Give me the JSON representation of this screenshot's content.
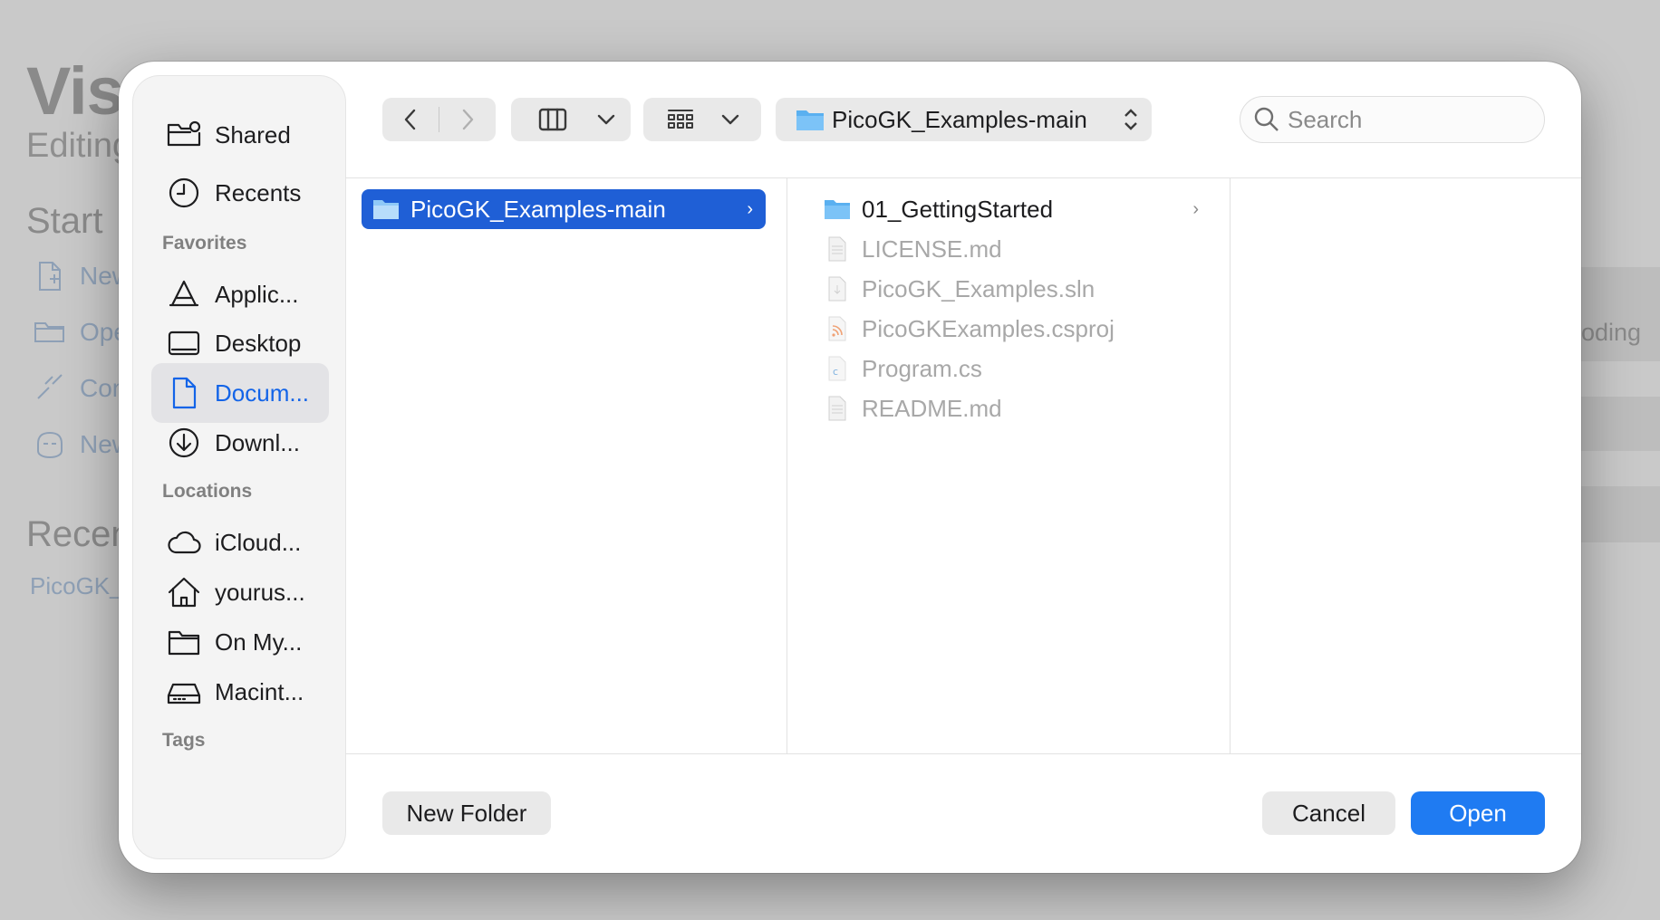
{
  "background_app": {
    "title": "Visu",
    "subtitle": "Editing",
    "start_heading": "Start",
    "links": [
      "New",
      "Ope",
      "Con",
      "New"
    ],
    "recent_heading": "Recen",
    "recent_item": "PicoGK_",
    "side_text": "oding"
  },
  "sidebar": {
    "top_items": [
      {
        "label": "Shared",
        "icon": "shared-folder-icon"
      },
      {
        "label": "Recents",
        "icon": "clock-icon"
      }
    ],
    "favorites_heading": "Favorites",
    "favorites": [
      {
        "label": "Applic...",
        "icon": "applications-icon"
      },
      {
        "label": "Desktop",
        "icon": "desktop-icon"
      },
      {
        "label": "Docum...",
        "icon": "document-icon",
        "active": true
      },
      {
        "label": "Downl...",
        "icon": "download-icon"
      }
    ],
    "locations_heading": "Locations",
    "locations": [
      {
        "label": "iCloud...",
        "icon": "cloud-icon"
      },
      {
        "label": "yourus...",
        "icon": "home-icon"
      },
      {
        "label": "On My...",
        "icon": "folder-icon"
      },
      {
        "label": "Macint...",
        "icon": "disk-icon"
      }
    ],
    "tags_heading": "Tags"
  },
  "toolbar": {
    "path_label": "PicoGK_Examples-main",
    "search_placeholder": "Search"
  },
  "browser": {
    "column1": [
      {
        "name": "PicoGK_Examples-main",
        "type": "folder",
        "selected": true
      }
    ],
    "column2": [
      {
        "name": "01_GettingStarted",
        "type": "folder",
        "enabled": true
      },
      {
        "name": "LICENSE.md",
        "type": "text-file",
        "enabled": false
      },
      {
        "name": "PicoGK_Examples.sln",
        "type": "sln-file",
        "enabled": false
      },
      {
        "name": "PicoGKExamples.csproj",
        "type": "rss-file",
        "enabled": false
      },
      {
        "name": "Program.cs",
        "type": "cs-file",
        "enabled": false
      },
      {
        "name": "README.md",
        "type": "text-file",
        "enabled": false
      }
    ]
  },
  "footer": {
    "new_folder": "New Folder",
    "cancel": "Cancel",
    "open": "Open"
  },
  "colors": {
    "accent": "#1f7bf2",
    "selection": "#1f5fd6",
    "folder": "#5ab0f0"
  }
}
